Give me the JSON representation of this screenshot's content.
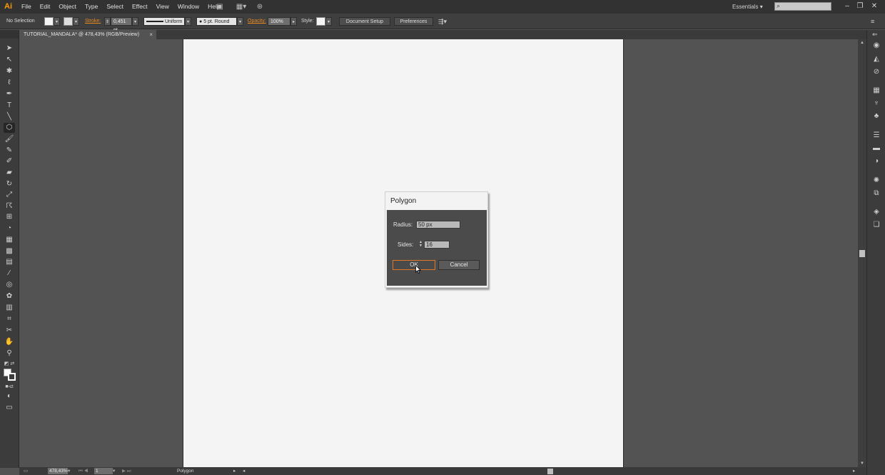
{
  "app": {
    "logo": "Ai",
    "menus": [
      "File",
      "Edit",
      "Object",
      "Type",
      "Select",
      "Effect",
      "View",
      "Window",
      "Help"
    ],
    "workspace": "Essentials",
    "search": {
      "value": "",
      "placeholder": ""
    }
  },
  "control_bar": {
    "selection": "No Selection",
    "stroke_label": "Stroke:",
    "stroke_weight": "0,451 pt",
    "stroke_profile": "Uniform",
    "brush": "5 pt. Round",
    "opacity_label": "Opacity:",
    "opacity_value": "100%",
    "style_label": "Style:",
    "document_setup": "Document Setup",
    "preferences": "Preferences"
  },
  "document": {
    "tab_title": "TUTORIAL_MANDALA* @ 478,43% (RGB/Preview)",
    "close_glyph": "×"
  },
  "status_bar": {
    "zoom": "478,43%",
    "artboard_number": "1",
    "current_tool": "Polygon"
  },
  "dialog": {
    "title": "Polygon",
    "radius_label": "Radius:",
    "radius_value": "50 px",
    "sides_label": "Sides:",
    "sides_value": "16",
    "ok_label": "OK",
    "cancel_label": "Cancel"
  },
  "colors": {
    "accent": "#e88a22",
    "ui_dark": "#3c3c3c",
    "canvas": "#535353",
    "artboard": "#f4f4f4"
  },
  "icons": {
    "tools": [
      "selection-tool",
      "direct-selection-tool",
      "magic-wand-tool",
      "lasso-tool",
      "pen-tool",
      "type-tool",
      "line-segment-tool",
      "polygon-tool",
      "paintbrush-tool",
      "pencil-tool",
      "blob-brush-tool",
      "eraser-tool",
      "rotate-tool",
      "scale-tool",
      "warp-tool",
      "free-transform-tool",
      "shape-builder-tool",
      "perspective-grid-tool",
      "mesh-tool",
      "gradient-tool",
      "eyedropper-tool",
      "blend-tool",
      "symbol-sprayer-tool",
      "column-graph-tool",
      "artboard-tool",
      "slice-tool",
      "hand-tool",
      "zoom-tool"
    ],
    "dock": [
      "color-panel",
      "color-guide-panel",
      "appearance-panel",
      "swatches-panel",
      "brushes-panel",
      "symbols-panel",
      "stroke-panel",
      "gradient-panel",
      "transparency-panel",
      "graphic-styles-panel",
      "image-trace-panel",
      "layers-panel",
      "artboards-panel"
    ]
  }
}
